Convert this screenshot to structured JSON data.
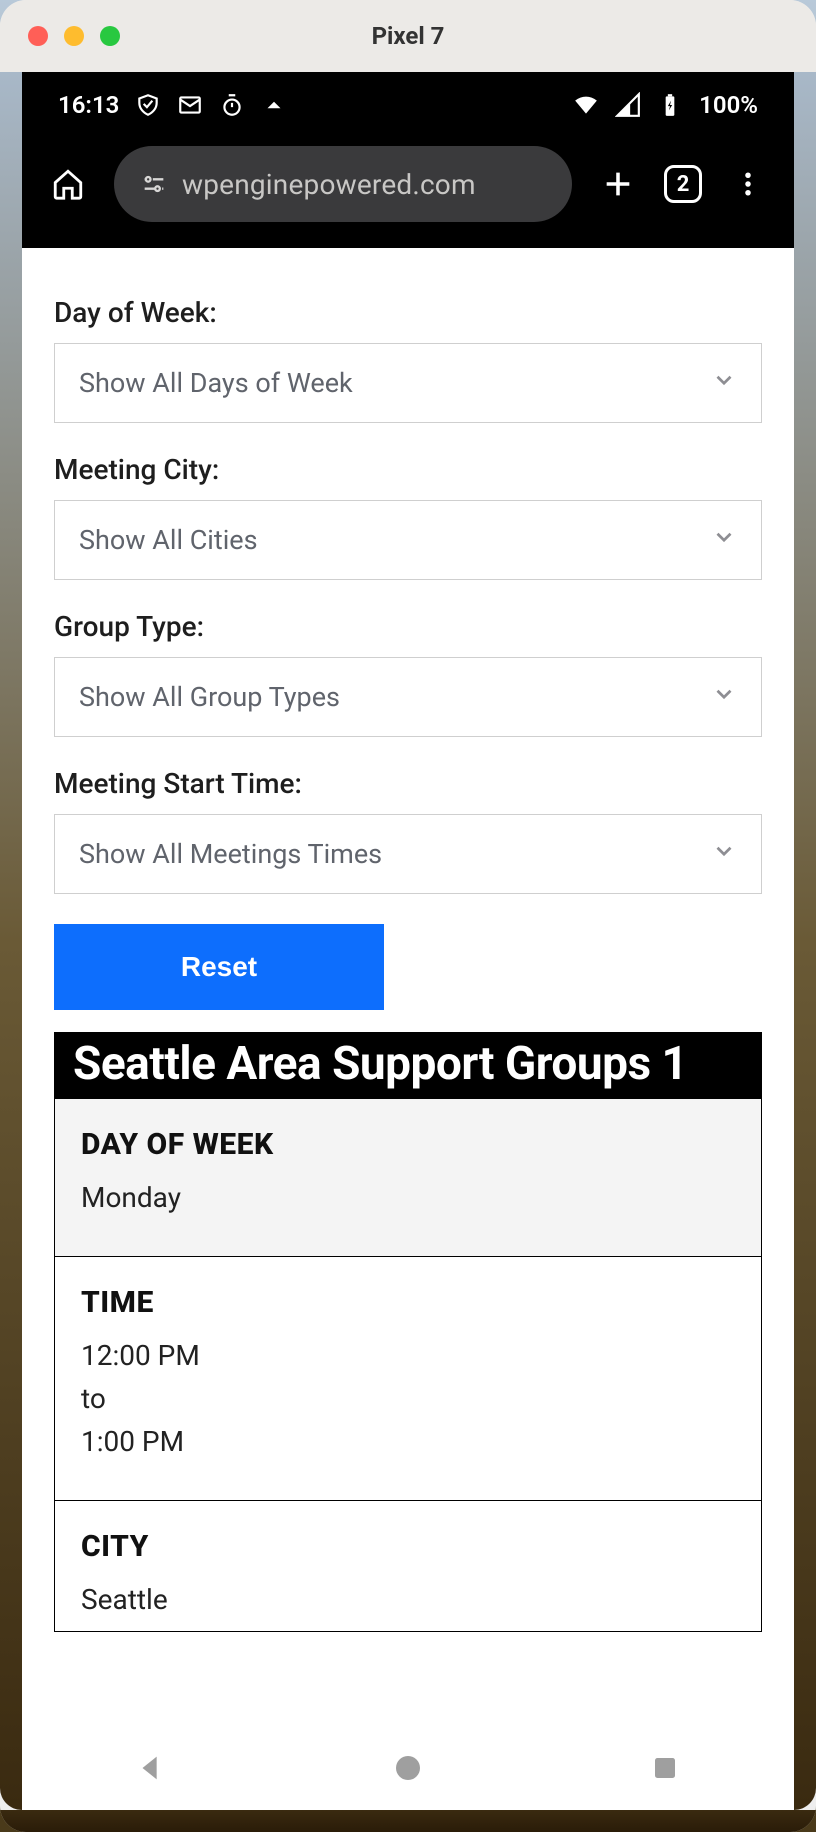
{
  "mac": {
    "title": "Pixel 7"
  },
  "status": {
    "time": "16:13",
    "battery": "100%"
  },
  "chrome": {
    "url": "wpenginepowered.com",
    "tab_count": "2"
  },
  "filters": {
    "day_label": "Day of Week:",
    "day_select": "Show All Days of Week",
    "city_label": "Meeting City:",
    "city_select": "Show All Cities",
    "type_label": "Group Type:",
    "type_select": "Show All Group Types",
    "time_label": "Meeting Start Time:",
    "time_select": "Show All Meetings Times",
    "reset": "Reset"
  },
  "card": {
    "title": "Seattle Area Support Groups 1",
    "rows": {
      "day_header": "DAY OF WEEK",
      "day_value": "Monday",
      "time_header": "TIME",
      "time_start": "12:00 PM",
      "time_sep": "to",
      "time_end": "1:00 PM",
      "city_header": "CITY",
      "city_value": "Seattle"
    }
  }
}
